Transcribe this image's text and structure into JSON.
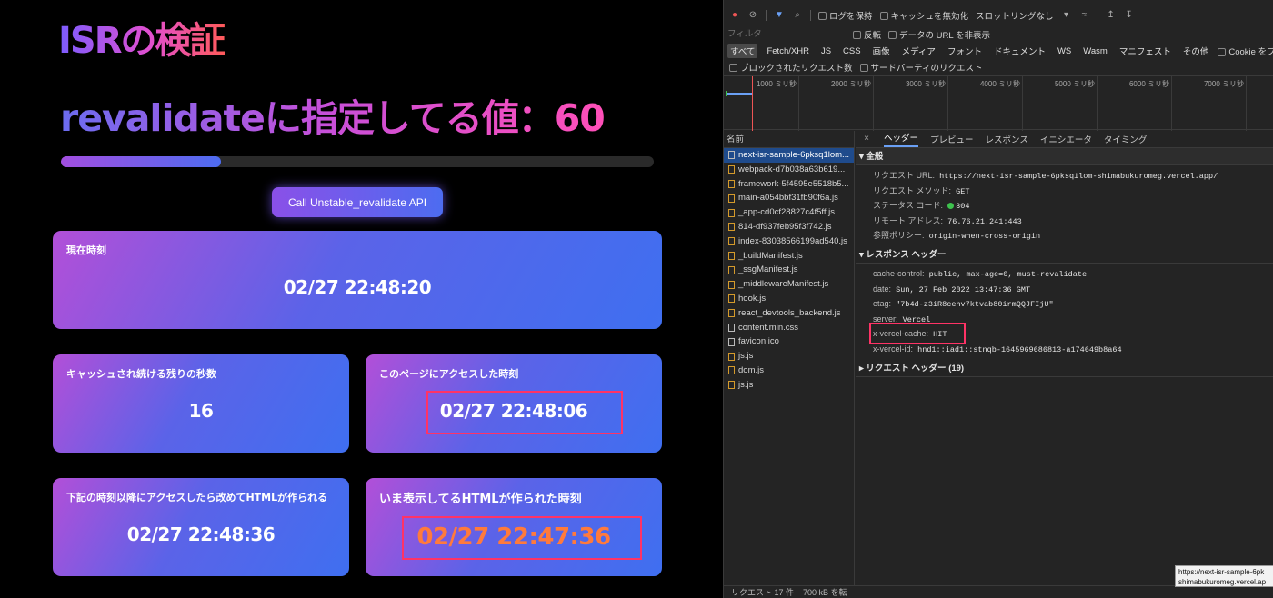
{
  "app": {
    "title": "ISRの検証",
    "subtitle": "revalidateに指定してる値：60",
    "progress_fraction": 0.27,
    "api_button": "Call Unstable_revalidate API",
    "cards": {
      "now": {
        "label": "現在時刻",
        "value": "02/27 22:48:20"
      },
      "remaining": {
        "label": "キャッシュされ続ける残りの秒数",
        "value": "16"
      },
      "accessed": {
        "label": "このページにアクセスした時刻",
        "value": "02/27 22:48:06"
      },
      "next_build": {
        "label": "下記の時刻以降にアクセスしたら改めてHTMLが作られる",
        "value": "02/27 22:48:36"
      },
      "built": {
        "label": "いま表示してるHTMLが作られた時刻",
        "value": "02/27 22:47:36"
      }
    }
  },
  "devtools": {
    "toolbar": {
      "preserve_log": "ログを保持",
      "disable_cache": "キャッシュを無効化",
      "throttling": "スロットリングなし"
    },
    "filter": {
      "placeholder": "フィルタ",
      "invert": "反転",
      "hide_data_urls": "データの URL を非表示"
    },
    "types": [
      "すべて",
      "Fetch/XHR",
      "JS",
      "CSS",
      "画像",
      "メディア",
      "フォント",
      "ドキュメント",
      "WS",
      "Wasm",
      "マニフェスト",
      "その他"
    ],
    "block_cookies": "Cookie をブロックしました",
    "blocked_requests": "ブロックされたリクエスト数",
    "third_party": "サードパーティのリクエスト",
    "timeline_ticks": [
      "1000 ミリ秒",
      "2000 ミリ秒",
      "3000 ミリ秒",
      "4000 ミリ秒",
      "5000 ミリ秒",
      "6000 ミリ秒",
      "7000 ミリ秒"
    ],
    "name_header": "名前",
    "files": [
      {
        "name": "next-isr-sample-6pksq1lom...",
        "kind": "doc"
      },
      {
        "name": "webpack-d7b038a63b619...",
        "kind": "js"
      },
      {
        "name": "framework-5f4595e5518b5...",
        "kind": "js"
      },
      {
        "name": "main-a054bbf31fb90f6a.js",
        "kind": "js"
      },
      {
        "name": "_app-cd0cf28827c4f5ff.js",
        "kind": "js"
      },
      {
        "name": "814-df937feb95f3f742.js",
        "kind": "js"
      },
      {
        "name": "index-83038566199ad540.js",
        "kind": "js"
      },
      {
        "name": "_buildManifest.js",
        "kind": "js"
      },
      {
        "name": "_ssgManifest.js",
        "kind": "js"
      },
      {
        "name": "_middlewareManifest.js",
        "kind": "js"
      },
      {
        "name": "hook.js",
        "kind": "js"
      },
      {
        "name": "react_devtools_backend.js",
        "kind": "js"
      },
      {
        "name": "content.min.css",
        "kind": "css"
      },
      {
        "name": "favicon.ico",
        "kind": "doc"
      },
      {
        "name": "js.js",
        "kind": "js"
      },
      {
        "name": "dom.js",
        "kind": "js"
      },
      {
        "name": "js.js",
        "kind": "js"
      }
    ],
    "tabs": [
      "ヘッダー",
      "プレビュー",
      "レスポンス",
      "イニシエータ",
      "タイミング"
    ],
    "general": {
      "title": "全般",
      "request_url_label": "リクエスト URL:",
      "request_url": "https://next-isr-sample-6pksq1lom-shimabukuromeg.vercel.app/",
      "method_label": "リクエスト メソッド:",
      "method": "GET",
      "status_label": "ステータス コード:",
      "status": "304",
      "remote_label": "リモート アドレス:",
      "remote": "76.76.21.241:443",
      "referrer_label": "参照ポリシー:",
      "referrer": "origin-when-cross-origin"
    },
    "response_headers": {
      "title": "レスポンス ヘッダー",
      "items": [
        {
          "k": "cache-control:",
          "v": "public, max-age=0, must-revalidate"
        },
        {
          "k": "date:",
          "v": "Sun, 27 Feb 2022 13:47:36 GMT"
        },
        {
          "k": "etag:",
          "v": "\"7b4d-z3iR8cehv7ktvab80irmQQJFIjU\""
        },
        {
          "k": "server:",
          "v": "Vercel"
        },
        {
          "k": "x-vercel-cache:",
          "v": "HIT"
        },
        {
          "k": "x-vercel-id:",
          "v": "hnd1::iad1::stnqb-1645969686813-a174649b8a64"
        }
      ]
    },
    "request_headers_title": "リクエスト ヘッダー (19)",
    "status_bar": {
      "requests": "リクエスト 17 件",
      "transferred": "700 kB を転"
    },
    "tooltip": {
      "line1": "https://next-isr-sample-6pk",
      "line2": "shimabukuromeg.vercel.ap"
    }
  }
}
